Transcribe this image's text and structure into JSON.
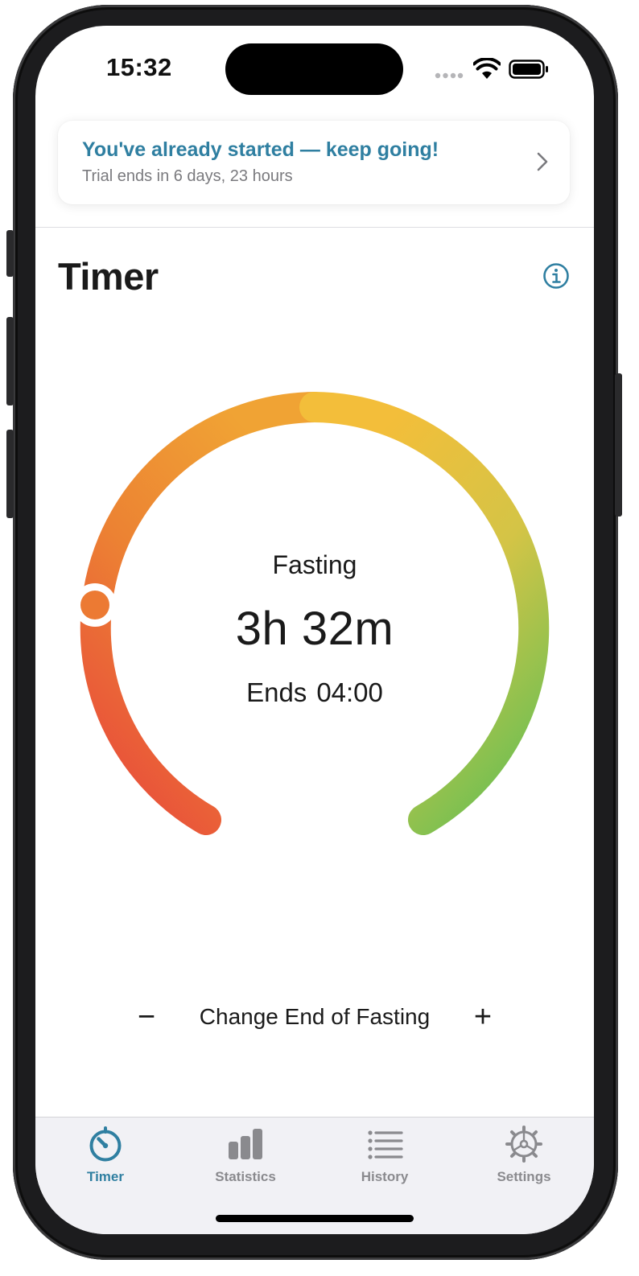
{
  "status_bar": {
    "time": "15:32"
  },
  "banner": {
    "title": "You've already started — keep going!",
    "subtitle": "Trial ends in 6 days, 23 hours"
  },
  "header": {
    "title": "Timer"
  },
  "gauge": {
    "state_label": "Fasting",
    "elapsed": "3h 32m",
    "ends_label": "Ends",
    "ends_time": "04:00",
    "colors": {
      "start": "#e8453c",
      "middle": "#f3be3a",
      "end": "#5cbf55"
    }
  },
  "adjust": {
    "minus_symbol": "−",
    "label": "Change End of Fasting",
    "plus_symbol": "+"
  },
  "tabs": [
    {
      "label": "Timer",
      "icon": "timer-icon",
      "active": true
    },
    {
      "label": "Statistics",
      "icon": "bar-chart-icon",
      "active": false
    },
    {
      "label": "History",
      "icon": "list-icon",
      "active": false
    },
    {
      "label": "Settings",
      "icon": "gear-icon",
      "active": false
    }
  ],
  "theme": {
    "accent": "#2f7fa1",
    "inactive": "#8a8a8e"
  }
}
